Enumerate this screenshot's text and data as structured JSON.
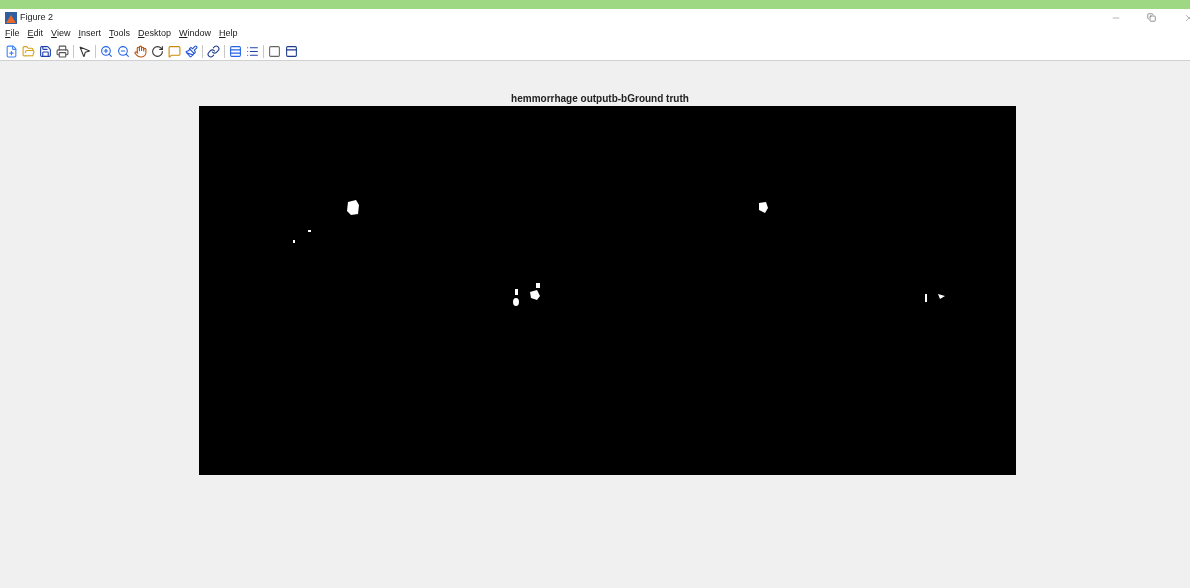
{
  "window": {
    "title": "Figure 2"
  },
  "menu": [
    "File",
    "Edit",
    "View",
    "Insert",
    "Tools",
    "Desktop",
    "Window",
    "Help"
  ],
  "axes": {
    "title": "hemmorrhage outputb-bGround truth"
  }
}
